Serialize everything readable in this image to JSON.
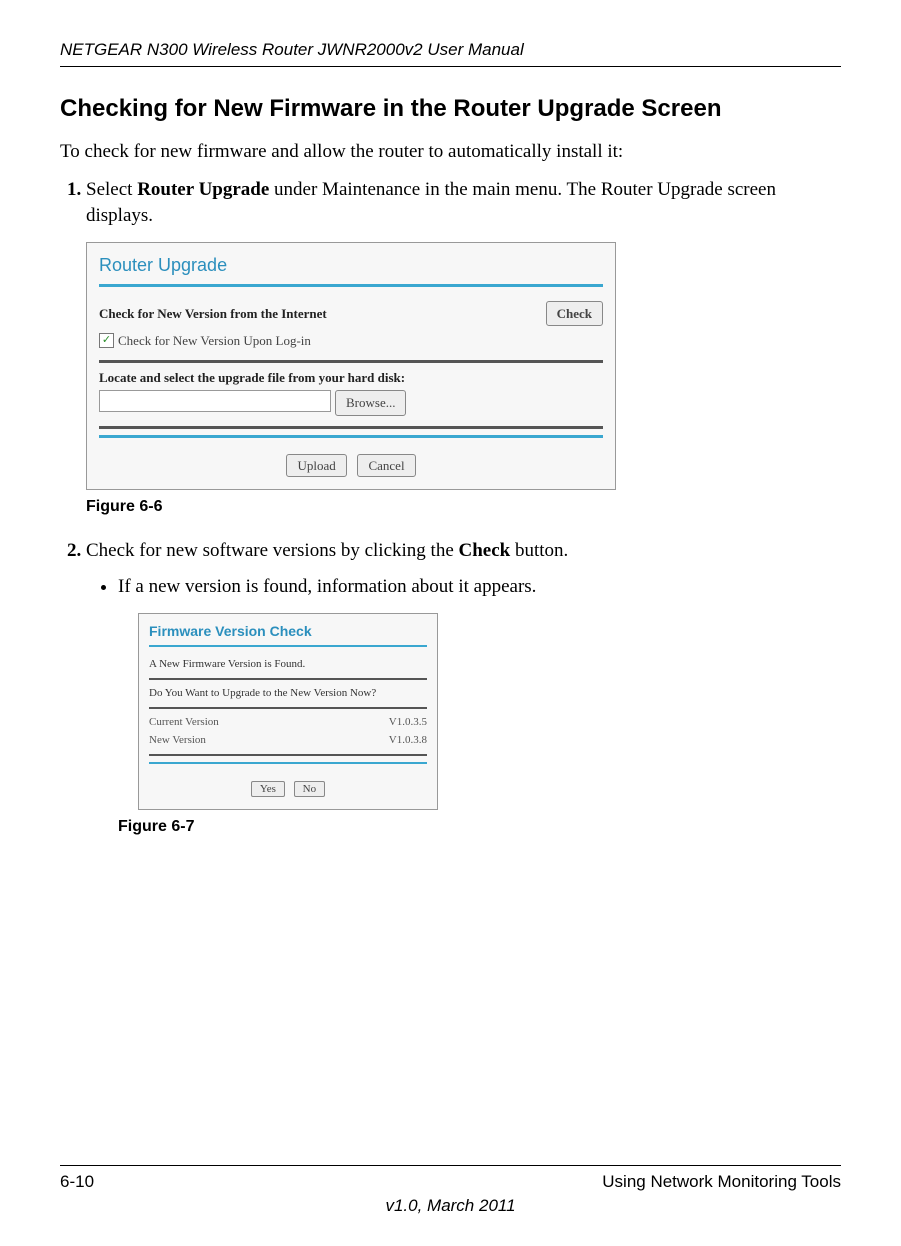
{
  "header": {
    "title": "NETGEAR N300 Wireless Router JWNR2000v2 User Manual"
  },
  "section": {
    "heading": "Checking for New Firmware in the Router Upgrade Screen",
    "intro": "To check for new firmware and allow the router to automatically install it:"
  },
  "steps": {
    "s1_before": "Select ",
    "s1_bold": "Router Upgrade",
    "s1_after": " under Maintenance in the main menu. The Router Upgrade screen displays.",
    "s2_before": "Check for new software versions by clicking the ",
    "s2_bold": "Check",
    "s2_after": " button.",
    "s2_sub": "If a new version is found, information about it appears."
  },
  "fig1": {
    "caption": "Figure 6-6",
    "title": "Router Upgrade",
    "check_label": "Check for New Version from the Internet",
    "check_button": "Check",
    "checkbox_label": "Check for New Version Upon Log-in",
    "locate_label": "Locate and select the upgrade file from your hard disk:",
    "browse": "Browse...",
    "upload": "Upload",
    "cancel": "Cancel"
  },
  "fig2": {
    "caption": "Figure 6-7",
    "title": "Firmware Version Check",
    "found": "A New Firmware Version is Found.",
    "question": "Do You Want to Upgrade to the New Version Now?",
    "cur_label": "Current Version",
    "cur_val": "V1.0.3.5",
    "new_label": "New Version",
    "new_val": "V1.0.3.8",
    "yes": "Yes",
    "no": "No"
  },
  "footer": {
    "page": "6-10",
    "section": "Using Network Monitoring Tools",
    "version": "v1.0, March 2011"
  }
}
